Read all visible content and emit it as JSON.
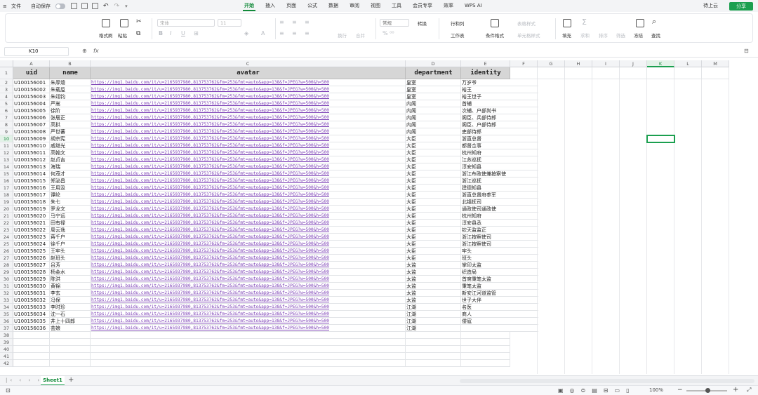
{
  "topbar": {
    "file_menu": "文件",
    "autosave_label": "自动保存",
    "tabs": [
      "开始",
      "插入",
      "页面",
      "公式",
      "数据",
      "审阅",
      "视图",
      "工具",
      "会员专享",
      "效率",
      "WPS AI"
    ],
    "upload_label": "待上云",
    "share_label": "分享"
  },
  "ribbon": {
    "format_painter": "格式刷",
    "paste": "粘贴",
    "font_name": "宋体",
    "font_size": "11",
    "number_format": "常规",
    "convert": "转换",
    "wrap": "换行",
    "merge": "合并",
    "rows_cols": "行和列",
    "worksheet": "工作表",
    "cond_format": "条件格式",
    "table_style": "表格样式",
    "cell_style": "单元格样式",
    "fill": "填充",
    "sum": "求和",
    "sort": "排序",
    "filter": "筛选",
    "freeze": "冻结",
    "find": "查找"
  },
  "formula_bar": {
    "name_box": "K10",
    "fx": "fx",
    "content": ""
  },
  "columns": [
    "A",
    "B",
    "C",
    "D",
    "E",
    "F",
    "G",
    "H",
    "I",
    "J",
    "K",
    "L",
    "M"
  ],
  "selected_cell": "K10",
  "headers": [
    "uid",
    "name",
    "avatar",
    "department",
    "identity"
  ],
  "avatar_url": "https://img1.baidu.com/it/u=2165937980,813753762&fm=253&fmt=auto&app=138&f=JPEG?w=500&h=500",
  "rows": [
    [
      "U100156001",
      "朱厚熜",
      "皇室",
      "万岁爷"
    ],
    [
      "U100156002",
      "朱载垕",
      "皇室",
      "裕王"
    ],
    [
      "U100156003",
      "朱翊钧",
      "皇室",
      "裕王世子"
    ],
    [
      "U100156004",
      "严嵩",
      "内阁",
      "首辅"
    ],
    [
      "U100156005",
      "徐阶",
      "内阁",
      "次辅、户部尚书"
    ],
    [
      "U100156006",
      "张居正",
      "内阁",
      "阁臣、兵部侍郎"
    ],
    [
      "U100156007",
      "高拱",
      "内阁",
      "阁臣、户部侍郎"
    ],
    [
      "U100156008",
      "严世蕃",
      "内阁",
      "吏部侍郎"
    ],
    [
      "U100156009",
      "胡宗宪",
      "大臣",
      "浙直总督"
    ],
    [
      "U100156010",
      "戚继光",
      "大臣",
      "都督佥事"
    ],
    [
      "U100156011",
      "高翰文",
      "大臣",
      "杭州知府"
    ],
    [
      "U100156012",
      "赵贞吉",
      "大臣",
      "江苏巡抚"
    ],
    [
      "U100156013",
      "海瑞",
      "大臣",
      "淳安知县"
    ],
    [
      "U100156014",
      "何茂才",
      "大臣",
      "浙江布政使兼按察使"
    ],
    [
      "U100156015",
      "郑泌昌",
      "大臣",
      "浙江巡抚"
    ],
    [
      "U100156016",
      "王用汲",
      "大臣",
      "建德知县"
    ],
    [
      "U100156017",
      "谭纶",
      "大臣",
      "浙直总督府参军"
    ],
    [
      "U100156018",
      "朱七",
      "大臣",
      "北镇抚司"
    ],
    [
      "U100156019",
      "罗龙文",
      "大臣",
      "通政使司通政使"
    ],
    [
      "U100156020",
      "马宁远",
      "大臣",
      "杭州知府"
    ],
    [
      "U100156021",
      "田有禄",
      "大臣",
      "淳安县丞"
    ],
    [
      "U100156022",
      "周云逸",
      "大臣",
      "钦天监监正"
    ],
    [
      "U100156023",
      "蒋千户",
      "大臣",
      "浙江按察使司"
    ],
    [
      "U100156024",
      "徐千户",
      "大臣",
      "浙江按察使司"
    ],
    [
      "U100156025",
      "王牢头",
      "大臣",
      "牢头"
    ],
    [
      "U100156026",
      "赵班头",
      "大臣",
      "班头"
    ],
    [
      "U100156027",
      "吕芳",
      "太监",
      "掌印太监"
    ],
    [
      "U100156028",
      "杨金水",
      "太监",
      "织造局"
    ],
    [
      "U100156029",
      "陈洪",
      "太监",
      "首席秉笔太监"
    ],
    [
      "U100156030",
      "黄锦",
      "太监",
      "秉笔太监"
    ],
    [
      "U100156031",
      "李玄",
      "太监",
      "新安江河道监管"
    ],
    [
      "U100156032",
      "冯保",
      "太监",
      "世子大伴"
    ],
    [
      "U100156033",
      "李时珍",
      "江湖",
      "名医"
    ],
    [
      "U100156034",
      "沈一石",
      "江湖",
      "商人"
    ],
    [
      "U100156035",
      "井上十四郎",
      "江湖",
      "倭寇"
    ],
    [
      "U100156036",
      "芸娘",
      "江湖",
      ""
    ]
  ],
  "total_row_headers": 42,
  "sheet_tabs": [
    "Sheet1"
  ],
  "status": {
    "zoom": "100%"
  }
}
